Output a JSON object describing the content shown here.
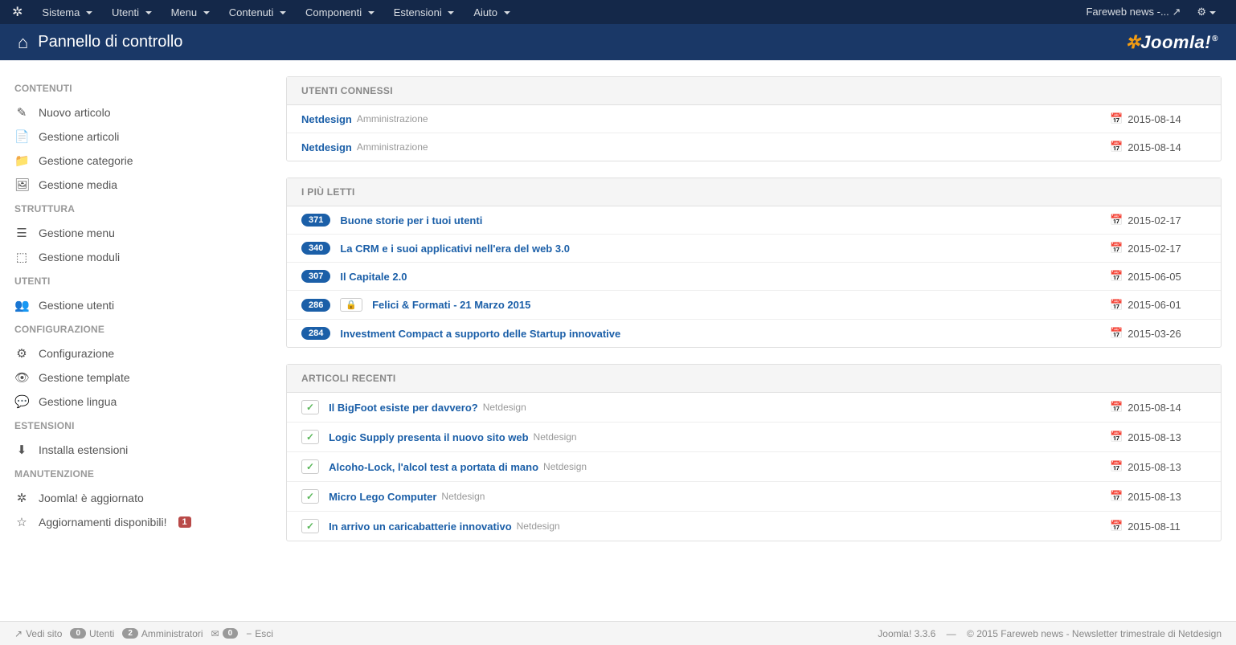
{
  "nav": {
    "items": [
      "Sistema",
      "Utenti",
      "Menu",
      "Contenuti",
      "Componenti",
      "Estensioni",
      "Aiuto"
    ],
    "site_name": "Fareweb news -..."
  },
  "header": {
    "title": "Pannello di controllo",
    "logo": "Joomla!"
  },
  "sidebar": {
    "sections": [
      {
        "title": "CONTENUTI",
        "items": [
          {
            "icon": "pencil",
            "label": "Nuovo articolo"
          },
          {
            "icon": "copy",
            "label": "Gestione articoli"
          },
          {
            "icon": "folder",
            "label": "Gestione categorie"
          },
          {
            "icon": "image",
            "label": "Gestione media"
          }
        ]
      },
      {
        "title": "STRUTTURA",
        "items": [
          {
            "icon": "list",
            "label": "Gestione menu"
          },
          {
            "icon": "cube",
            "label": "Gestione moduli"
          }
        ]
      },
      {
        "title": "UTENTI",
        "items": [
          {
            "icon": "users",
            "label": "Gestione utenti"
          }
        ]
      },
      {
        "title": "CONFIGURAZIONE",
        "items": [
          {
            "icon": "gear",
            "label": "Configurazione"
          },
          {
            "icon": "eye",
            "label": "Gestione template"
          },
          {
            "icon": "chat",
            "label": "Gestione lingua"
          }
        ]
      },
      {
        "title": "ESTENSIONI",
        "items": [
          {
            "icon": "download",
            "label": "Installa estensioni"
          }
        ]
      },
      {
        "title": "MANUTENZIONE",
        "items": [
          {
            "icon": "joomla",
            "label": "Joomla! è aggiornato"
          },
          {
            "icon": "star",
            "label": "Aggiornamenti disponibili!",
            "badge": "1"
          }
        ]
      }
    ]
  },
  "panels": {
    "logged_in": {
      "title": "UTENTI CONNESSI",
      "rows": [
        {
          "name": "Netdesign",
          "role": "Amministrazione",
          "date": "2015-08-14"
        },
        {
          "name": "Netdesign",
          "role": "Amministrazione",
          "date": "2015-08-14"
        }
      ]
    },
    "popular": {
      "title": "I PIÙ LETTI",
      "rows": [
        {
          "count": "371",
          "title": "Buone storie per i tuoi utenti",
          "date": "2015-02-17",
          "locked": false
        },
        {
          "count": "340",
          "title": "La CRM e i suoi applicativi nell'era del web 3.0",
          "date": "2015-02-17",
          "locked": false
        },
        {
          "count": "307",
          "title": "Il Capitale 2.0",
          "date": "2015-06-05",
          "locked": false
        },
        {
          "count": "286",
          "title": "Felici & Formati - 21 Marzo 2015",
          "date": "2015-06-01",
          "locked": true
        },
        {
          "count": "284",
          "title": "Investment Compact a supporto delle Startup innovative",
          "date": "2015-03-26",
          "locked": false
        }
      ]
    },
    "recent": {
      "title": "ARTICOLI RECENTI",
      "rows": [
        {
          "title": "Il BigFoot esiste per davvero?",
          "author": "Netdesign",
          "date": "2015-08-14"
        },
        {
          "title": "Logic Supply presenta il nuovo sito web",
          "author": "Netdesign",
          "date": "2015-08-13"
        },
        {
          "title": "Alcoho-Lock, l'alcol test a portata di mano",
          "author": "Netdesign",
          "date": "2015-08-13"
        },
        {
          "title": "Micro Lego Computer",
          "author": "Netdesign",
          "date": "2015-08-13"
        },
        {
          "title": "In arrivo un caricabatterie innovativo",
          "author": "Netdesign",
          "date": "2015-08-11"
        }
      ]
    }
  },
  "footer": {
    "view_site": "Vedi sito",
    "users_count": "0",
    "users_label": "Utenti",
    "admins_count": "2",
    "admins_label": "Amministratori",
    "msgs_count": "0",
    "logout": "Esci",
    "version": "Joomla! 3.3.6",
    "copyright": "© 2015 Fareweb news - Newsletter trimestrale di Netdesign"
  },
  "icons": {
    "pencil": "✎",
    "copy": "📄",
    "folder": "📁",
    "image": "🖼",
    "list": "☰",
    "cube": "⬚",
    "users": "👥",
    "gear": "⚙",
    "eye": "👁",
    "chat": "💬",
    "download": "⬇",
    "joomla": "✲",
    "star": "☆",
    "calendar": "📅",
    "lock": "🔒",
    "check": "✓",
    "external": "↗",
    "home": "⌂",
    "mail": "✉",
    "logout": "−"
  }
}
